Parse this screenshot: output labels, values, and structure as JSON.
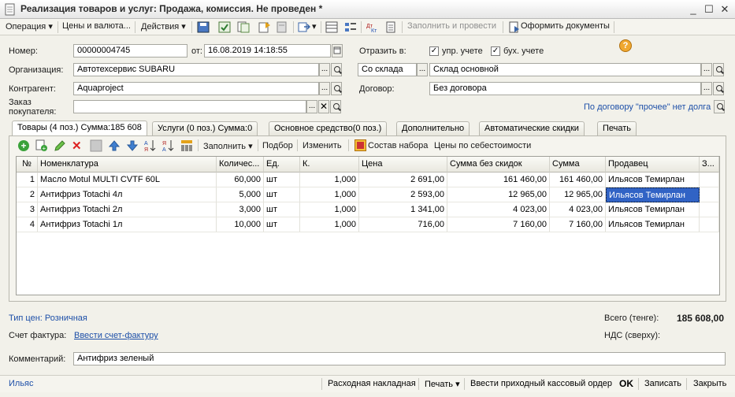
{
  "window": {
    "title": "Реализация товаров и услуг: Продажа, комиссия. Не проведен *"
  },
  "menu": {
    "operation": "Операция",
    "prices_currency": "Цены и валюта...",
    "actions": "Действия",
    "fill_and_post": "Заполнить и провести",
    "make_documents": "Оформить документы"
  },
  "header": {
    "number_label": "Номер:",
    "number_value": "00000004745",
    "date_label": "от:",
    "date_value": "16.08.2019 14:18:55",
    "reflect_label": "Отразить в:",
    "mgmt_label": "упр. учете",
    "mgmt_checked": true,
    "acc_label": "бух. учете",
    "acc_checked": true,
    "org_label": "Организация:",
    "org_value": "Автотехсервис SUBARU",
    "warehouse_mode": "Со склада",
    "warehouse_value": "Склад основной",
    "contractor_label": "Контрагент:",
    "contractor_value": "Aquaproject",
    "contract_label": "Договор:",
    "contract_value": "Без договора",
    "order_label_1": "Заказ",
    "order_label_2": "покупателя:",
    "order_value": "",
    "no_debt_link": "По договору \"прочее\" нет долга"
  },
  "tabs": [
    "Товары (4 поз.) Сумма:185 608",
    "Услуги (0 поз.) Сумма:0",
    "Основное средство(0 поз.)",
    "Дополнительно",
    "Автоматические скидки",
    "Печать"
  ],
  "grid_toolbar": {
    "fill": "Заполнить",
    "selection": "Подбор",
    "change": "Изменить",
    "kit": "Состав набора",
    "cost_prices": "Цены по себестоимости"
  },
  "table": {
    "columns": [
      "№",
      "Номенклатура",
      "Количес...",
      "Ед.",
      "К.",
      "Цена",
      "Сумма без скидок",
      "Сумма",
      "Продавец",
      "З..."
    ],
    "rows": [
      [
        "1",
        "Масло Motul MULTI CVTF 60L",
        "60,000",
        "шт",
        "1,000",
        "2 691,00",
        "161 460,00",
        "161 460,00",
        "Ильясов Темирлан",
        ""
      ],
      [
        "2",
        "Антифриз Totachi 4л",
        "5,000",
        "шт",
        "1,000",
        "2 593,00",
        "12 965,00",
        "12 965,00",
        "Ильясов Темирлан",
        ""
      ],
      [
        "3",
        "Антифриз Totachi 2л",
        "3,000",
        "шт",
        "1,000",
        "1 341,00",
        "4 023,00",
        "4 023,00",
        "Ильясов Темирлан",
        ""
      ],
      [
        "4",
        "Антифриз Totachi 1л",
        "10,000",
        "шт",
        "1,000",
        "716,00",
        "7 160,00",
        "7 160,00",
        "Ильясов Темирлан",
        ""
      ]
    ]
  },
  "footer": {
    "price_type": "Тип цен: Розничная",
    "invoice_label": "Счет фактура:",
    "invoice_link": "Ввести счет-фактуру",
    "total_label": "Всего (тенге):",
    "total_value": "185 608,00",
    "vat_label": "НДС (сверху):",
    "comment_label": "Комментарий:",
    "comment_value": "Антифриз зеленый"
  },
  "status": {
    "user": "Ильяс",
    "waybill": "Расходная накладная",
    "print": "Печать",
    "cash_order": "Ввести приходный кассовый ордер",
    "ok": "OK",
    "save": "Записать",
    "close": "Закрыть"
  },
  "colors": {
    "selection": "#3163c5",
    "link": "#1d4fa8",
    "background": "#f2f1ea"
  }
}
